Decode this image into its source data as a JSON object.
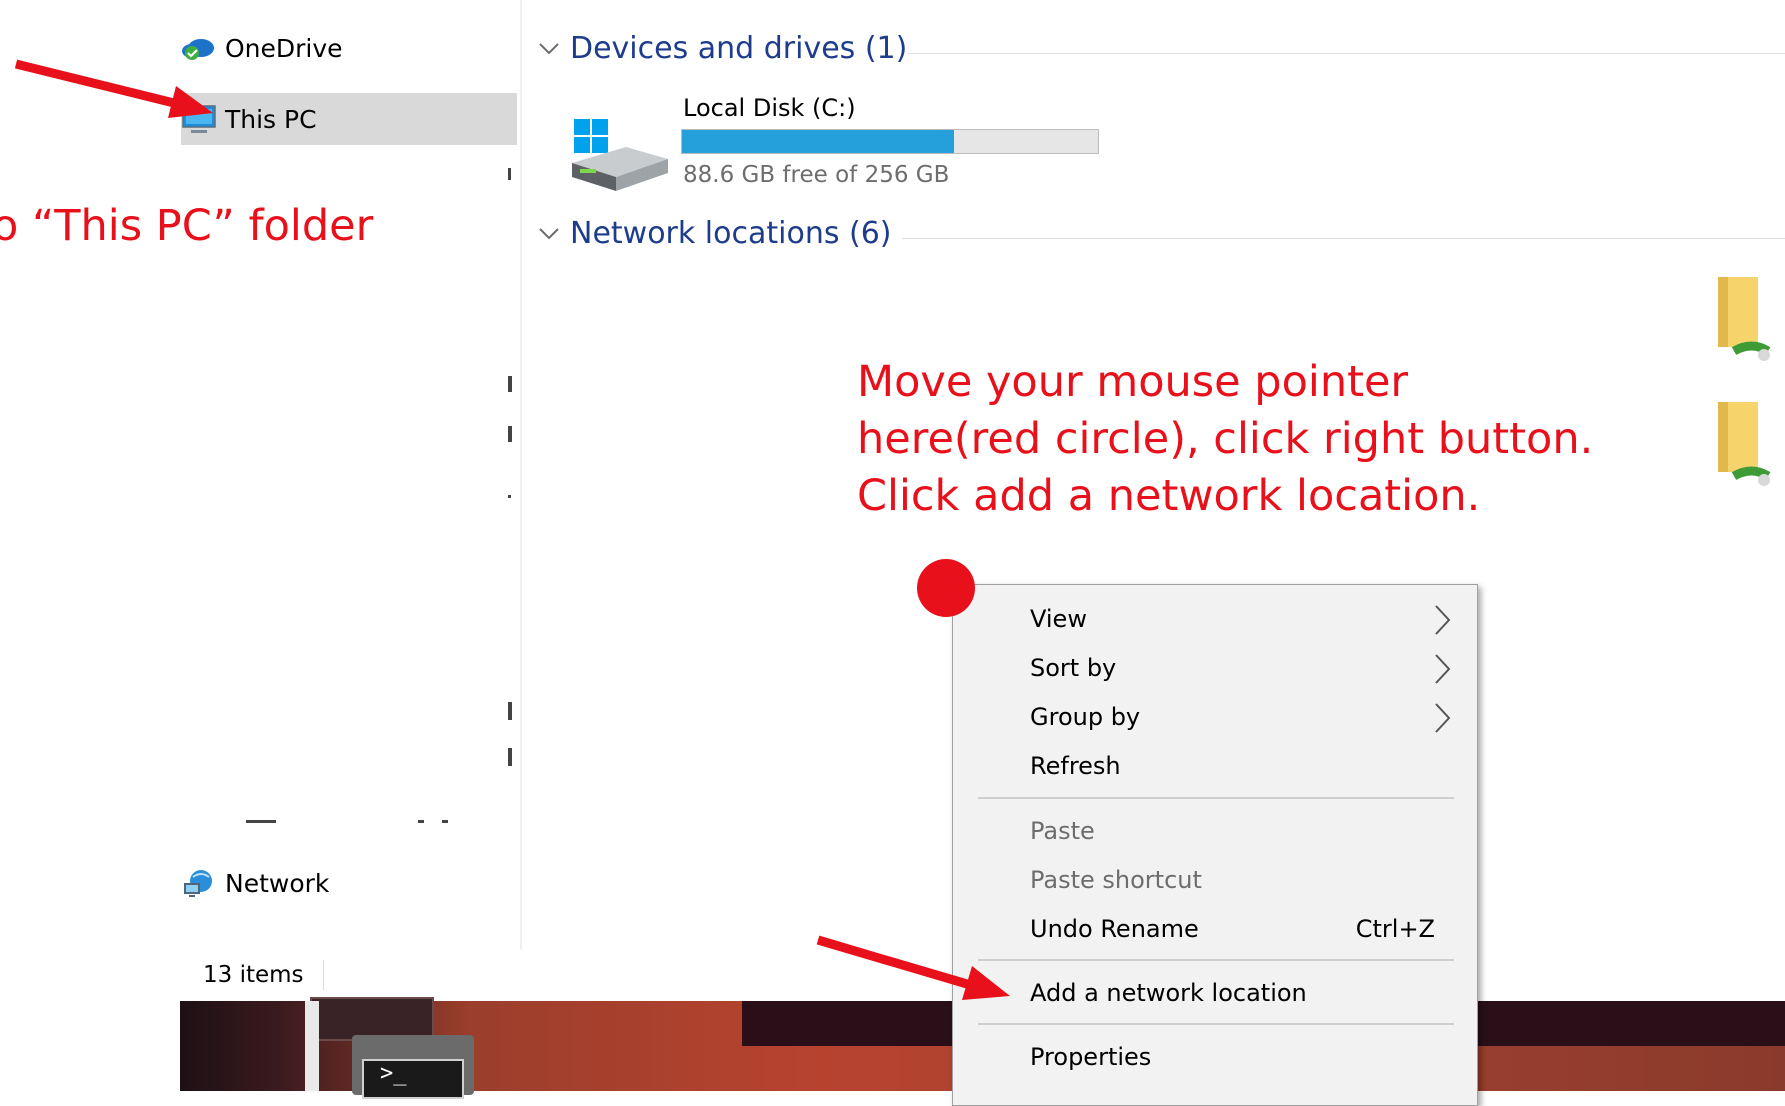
{
  "sidebar": {
    "onedrive": "OneDrive",
    "this_pc": "This PC",
    "network": "Network"
  },
  "main": {
    "devices_header": "Devices and drives (1)",
    "disk_name": "Local Disk (C:)",
    "disk_free": "88.6 GB free of 256 GB",
    "disk_used_fraction": 0.654,
    "network_header": "Network locations (6)"
  },
  "status_bar": {
    "items": "13 items"
  },
  "context_menu": {
    "items": [
      {
        "label": "View",
        "submenu": true
      },
      {
        "label": "Sort by",
        "submenu": true
      },
      {
        "label": "Group by",
        "submenu": true
      },
      {
        "label": "Refresh"
      },
      {
        "label": "Paste",
        "disabled": true
      },
      {
        "label": "Paste shortcut",
        "disabled": true
      },
      {
        "label": "Undo Rename",
        "shortcut": "Ctrl+Z"
      },
      {
        "label": "Add a network location"
      },
      {
        "label": "Properties"
      }
    ]
  },
  "annotations": {
    "left": "o “This PC” folder",
    "instructions": [
      "Move your mouse pointer",
      "here(red circle), click right button.",
      "Click add a network location."
    ]
  },
  "colors": {
    "accent_header": "#1e3c8c",
    "progress_fill": "#26a0da",
    "annotation_red": "#e8101a",
    "selected_bg": "#d9d9d9"
  }
}
